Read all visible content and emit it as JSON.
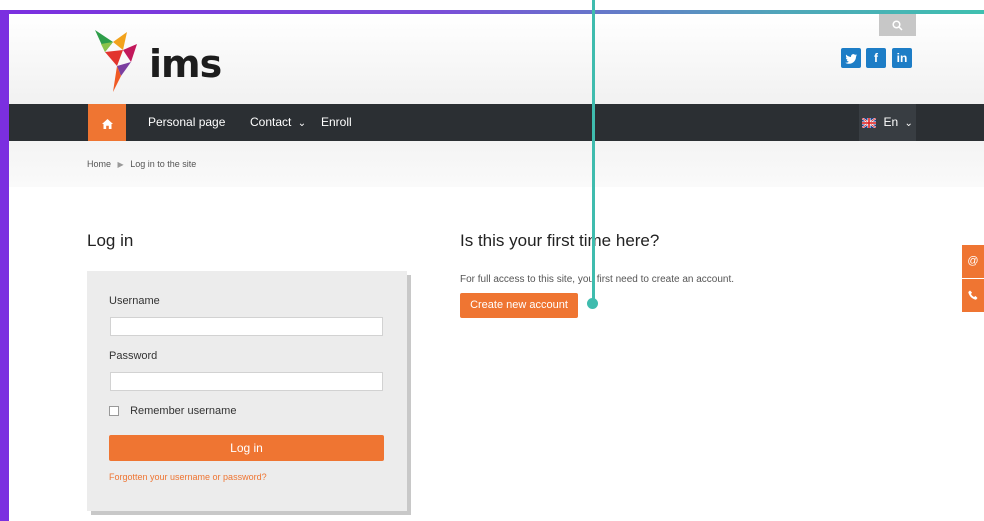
{
  "header": {
    "logo_text": "ims",
    "search_icon": "search-icon",
    "social": [
      {
        "name": "twitter",
        "glyph": "t"
      },
      {
        "name": "facebook",
        "glyph": "f"
      },
      {
        "name": "linkedin",
        "glyph": "in"
      }
    ]
  },
  "nav": {
    "home_icon": "home-icon",
    "items": [
      "Personal page",
      "Contact",
      "Enroll"
    ],
    "contact_caret": "⌄",
    "language": "En"
  },
  "breadcrumb": {
    "home": "Home",
    "current": "Log in to the site"
  },
  "login": {
    "title": "Log in",
    "username_label": "Username",
    "username_value": "",
    "password_label": "Password",
    "password_value": "",
    "remember_label": "Remember username",
    "button_label": "Log in",
    "forgot_link": "Forgotten your username or password?"
  },
  "signup": {
    "title": "Is this your first time here?",
    "description": "For full access to this site, you first need to create an account.",
    "button_label": "Create new account"
  },
  "colors": {
    "accent": "#ef7532",
    "nav_bg": "#2b2f33",
    "frame": "#7b2fe0",
    "annotation": "#3fbcae"
  }
}
